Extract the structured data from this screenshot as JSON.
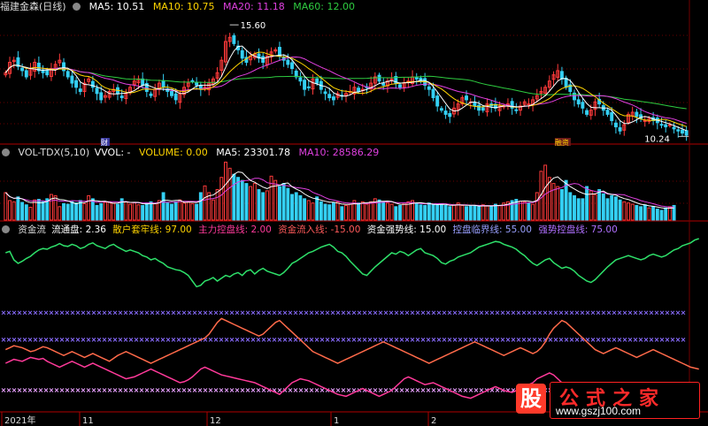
{
  "main_header": {
    "title": "福建金森(日线)",
    "ma5": "MA5: 10.51",
    "ma10": "MA10: 10.75",
    "ma20": "MA20: 11.18",
    "ma60": "MA60: 12.00"
  },
  "vol_header": {
    "title": "VOL-TDX(5,10)",
    "vvol": "VVOL: -",
    "volume": "VOLUME: 0.00",
    "ma5": "MA5: 23301.78",
    "ma10": "MA10: 28586.29"
  },
  "fund_header": {
    "title": "资金流",
    "float_cap": "流通盘: 2.36",
    "retail": "散户套牢线: 97.00",
    "main_control": "主力控盘线: 2.00",
    "inflow": "资金流入线: -15.00",
    "strong": "资金强势线: 15.00",
    "critical": "控盘临界线: 55.00",
    "strong_control": "强势控盘线: 75.00"
  },
  "annotations": {
    "high": "15.60",
    "low": "10.24",
    "tag1": "财",
    "tag2": "融资"
  },
  "x_axis": [
    "2021年",
    "11",
    "12",
    "1",
    "2"
  ],
  "watermark": {
    "stock": "股",
    "brand": "公式之家",
    "url": "www.gszj100.com"
  },
  "colors": {
    "up": "#ff3a3a",
    "down": "#34d0f4",
    "ma5": "#ffffff",
    "ma10": "#ffd400",
    "ma20": "#e040e0",
    "ma60": "#2ecc40",
    "fund": "#2ee06a",
    "pink": "#ff3a9a",
    "orange": "#ff6a4a",
    "xline": "#8a6cff"
  },
  "chart_data": [
    {
      "type": "candlestick",
      "title": "福建金森(日线)",
      "series": [
        {
          "name": "MA5",
          "value": 10.51
        },
        {
          "name": "MA10",
          "value": 10.75
        },
        {
          "name": "MA20",
          "value": 11.18
        },
        {
          "name": "MA60",
          "value": 12.0
        }
      ],
      "annotations": [
        {
          "label": "15.60",
          "kind": "high"
        },
        {
          "label": "10.24",
          "kind": "low"
        }
      ],
      "ylim": [
        10.0,
        16.2
      ],
      "close": [
        13.3,
        13.8,
        13.9,
        13.6,
        13.4,
        13.1,
        13.5,
        13.8,
        13.4,
        13.3,
        13.2,
        13.5,
        13.7,
        13.9,
        13.4,
        13.1,
        12.8,
        12.6,
        12.4,
        12.8,
        13.0,
        12.6,
        12.3,
        12.0,
        12.2,
        12.4,
        12.5,
        12.3,
        12.1,
        12.3,
        12.6,
        12.9,
        13.0,
        12.7,
        12.4,
        12.2,
        12.5,
        12.8,
        12.6,
        12.4,
        12.2,
        12.0,
        12.3,
        12.6,
        12.8,
        12.9,
        12.7,
        12.5,
        12.6,
        12.8,
        13.0,
        13.3,
        13.9,
        14.8,
        15.0,
        14.7,
        14.4,
        14.0,
        13.8,
        14.1,
        14.2,
        14.0,
        13.8,
        14.1,
        14.3,
        14.4,
        14.1,
        13.9,
        13.7,
        13.5,
        13.1,
        12.9,
        12.5,
        12.6,
        13.0,
        12.8,
        12.5,
        12.3,
        12.1,
        12.0,
        12.3,
        12.2,
        12.3,
        12.4,
        12.6,
        12.4,
        12.5,
        12.6,
        12.8,
        13.1,
        12.9,
        12.7,
        12.9,
        13.0,
        12.8,
        12.6,
        12.8,
        12.9,
        13.1,
        13.0,
        12.9,
        12.7,
        12.5,
        12.1,
        11.7,
        11.5,
        11.3,
        11.2,
        11.6,
        11.8,
        12.1,
        12.0,
        11.9,
        11.7,
        11.5,
        11.5,
        11.8,
        11.7,
        11.6,
        11.7,
        11.7,
        11.8,
        11.6,
        11.5,
        11.7,
        11.9,
        11.8,
        12.0,
        12.2,
        12.4,
        12.6,
        12.9,
        13.2,
        13.4,
        13.0,
        12.6,
        12.4,
        12.0,
        11.8,
        11.6,
        11.3,
        11.5,
        11.9,
        11.8,
        11.5,
        11.3,
        11.0,
        10.7,
        10.5,
        10.8,
        11.3,
        11.4,
        11.2,
        11.1,
        11.0,
        11.1,
        11.0,
        10.9,
        10.8,
        10.7,
        10.8,
        10.6,
        10.5,
        10.4,
        10.3
      ]
    },
    {
      "type": "bar",
      "title": "VOL-TDX(5,10)",
      "series": [
        {
          "name": "VOLUME",
          "value": 0.0
        },
        {
          "name": "MA5",
          "value": 23301.78
        },
        {
          "name": "MA10",
          "value": 28586.29
        }
      ],
      "ylim": [
        0,
        100000
      ],
      "values": [
        45000,
        32000,
        30000,
        38000,
        29000,
        25000,
        21000,
        33000,
        34000,
        30000,
        35000,
        42000,
        40000,
        22000,
        27000,
        26000,
        30000,
        28000,
        32000,
        27000,
        40000,
        35000,
        24000,
        27000,
        29000,
        30000,
        28000,
        26000,
        35000,
        30000,
        26000,
        29000,
        25000,
        24000,
        28000,
        30000,
        27000,
        32000,
        45000,
        28000,
        26000,
        30000,
        33000,
        28000,
        30000,
        27000,
        26000,
        45000,
        56000,
        45000,
        33000,
        50000,
        70000,
        95000,
        85000,
        75000,
        70000,
        65000,
        60000,
        55000,
        60000,
        50000,
        45000,
        48000,
        72000,
        65000,
        55000,
        60000,
        52000,
        42000,
        45000,
        40000,
        35000,
        32000,
        28000,
        38000,
        30000,
        26000,
        25000,
        28000,
        30000,
        22000,
        24000,
        26000,
        32000,
        28000,
        30000,
        26000,
        30000,
        35000,
        33000,
        30000,
        28000,
        26000,
        22000,
        24000,
        28000,
        30000,
        32000,
        27000,
        25000,
        24000,
        28000,
        26000,
        24000,
        26000,
        24000,
        22000,
        25000,
        28000,
        24000,
        22000,
        23000,
        24000,
        22000,
        25000,
        23000,
        22000,
        26000,
        24000,
        28000,
        30000,
        32000,
        34000,
        31000,
        30000,
        28000,
        26000,
        45000,
        80000,
        90000,
        70000,
        60000,
        55000,
        50000,
        65000,
        45000,
        40000,
        35000,
        35000,
        55000,
        48000,
        42000,
        50000,
        43000,
        35000,
        40000,
        38000,
        33000,
        30000,
        28000,
        26000,
        24000,
        22000,
        25000,
        20000,
        22000,
        18000,
        16000,
        20000,
        22000,
        24000
      ]
    },
    {
      "type": "line",
      "title": "资金流",
      "series": [
        {
          "name": "流通盘",
          "value": 2.36
        }
      ],
      "reference_lines": [
        {
          "name": "散户套牢线",
          "value": 97
        },
        {
          "name": "主力控盘线",
          "value": 2
        },
        {
          "name": "资金流入线",
          "value": -15
        },
        {
          "name": "资金强势线",
          "value": 15
        },
        {
          "name": "控盘临界线",
          "value": 55
        },
        {
          "name": "强势控盘线",
          "value": 75
        }
      ],
      "green": [
        70,
        72,
        60,
        55,
        58,
        62,
        65,
        70,
        74,
        76,
        75,
        78,
        80,
        83,
        80,
        79,
        82,
        80,
        76,
        78,
        82,
        84,
        80,
        78,
        76,
        80,
        82,
        78,
        75,
        72,
        74,
        72,
        70,
        66,
        64,
        60,
        62,
        58,
        55,
        50,
        48,
        46,
        45,
        42,
        38,
        30,
        22,
        24,
        30,
        32,
        35,
        30,
        34,
        38,
        36,
        40,
        42,
        38,
        44,
        46,
        40,
        45,
        48,
        44,
        42,
        40,
        38,
        42,
        48,
        55,
        58,
        62,
        66,
        70,
        72,
        75,
        78,
        80,
        82,
        78,
        72,
        70,
        65,
        58,
        52,
        46,
        40,
        38,
        44,
        50,
        55,
        60,
        65,
        70,
        68,
        72,
        70,
        66,
        70,
        74,
        76,
        70,
        68,
        66,
        62,
        56,
        54,
        58,
        60,
        64,
        66,
        68,
        70,
        74,
        78,
        80,
        82,
        84,
        86,
        85,
        82,
        80,
        78,
        75,
        70,
        66,
        60,
        55,
        52,
        56,
        60,
        62,
        56,
        52,
        48,
        50,
        48,
        44,
        38,
        34,
        30,
        28,
        32,
        38,
        44,
        50,
        55,
        60,
        62,
        64,
        66,
        64,
        62,
        60,
        62,
        66,
        68,
        66,
        64,
        66,
        70,
        74,
        76,
        80,
        82,
        84,
        88,
        90
      ],
      "pink": [
        50,
        52,
        54,
        53,
        52,
        54,
        56,
        55,
        54,
        55,
        52,
        50,
        48,
        46,
        48,
        50,
        52,
        50,
        48,
        46,
        48,
        50,
        48,
        46,
        44,
        42,
        40,
        38,
        36,
        34,
        35,
        36,
        38,
        40,
        42,
        44,
        42,
        40,
        38,
        36,
        34,
        32,
        30,
        31,
        33,
        36,
        40,
        44,
        46,
        44,
        42,
        40,
        38,
        37,
        36,
        35,
        34,
        33,
        32,
        31,
        30,
        28,
        26,
        24,
        22,
        20,
        18,
        22,
        26,
        30,
        32,
        34,
        33,
        32,
        30,
        28,
        26,
        24,
        22,
        20,
        18,
        17,
        16,
        18,
        20,
        22,
        24,
        22,
        20,
        18,
        16,
        18,
        20,
        22,
        26,
        30,
        34,
        36,
        34,
        32,
        30,
        28,
        29,
        30,
        28,
        26,
        24,
        22,
        20,
        18,
        16,
        15,
        14,
        16,
        18,
        20,
        22,
        24,
        26,
        24,
        22,
        21,
        20,
        22,
        24,
        26,
        28,
        30,
        34,
        36,
        38,
        40,
        38,
        34,
        30,
        26,
        24,
        22,
        20,
        18,
        17,
        16,
        15,
        16,
        18,
        20,
        22,
        24,
        26,
        28,
        26,
        24,
        22,
        20,
        18,
        20,
        22,
        24,
        26,
        24,
        22,
        20,
        18,
        17,
        16,
        15,
        14
      ],
      "orange": [
        64,
        66,
        68,
        67,
        66,
        64,
        62,
        63,
        65,
        67,
        66,
        64,
        62,
        60,
        58,
        60,
        62,
        60,
        58,
        56,
        58,
        60,
        58,
        56,
        54,
        52,
        55,
        58,
        60,
        62,
        60,
        58,
        56,
        54,
        52,
        50,
        52,
        54,
        56,
        58,
        60,
        62,
        64,
        66,
        68,
        70,
        72,
        74,
        76,
        80,
        86,
        92,
        96,
        94,
        92,
        90,
        88,
        86,
        84,
        82,
        80,
        78,
        80,
        84,
        88,
        92,
        94,
        90,
        86,
        82,
        78,
        74,
        70,
        66,
        62,
        60,
        58,
        56,
        54,
        52,
        50,
        52,
        54,
        56,
        58,
        60,
        62,
        64,
        66,
        68,
        70,
        72,
        70,
        68,
        66,
        64,
        62,
        60,
        58,
        56,
        54,
        52,
        50,
        52,
        54,
        56,
        58,
        60,
        62,
        64,
        66,
        68,
        70,
        72,
        70,
        68,
        66,
        64,
        62,
        60,
        58,
        60,
        62,
        64,
        66,
        64,
        62,
        60,
        62,
        66,
        72,
        80,
        86,
        90,
        94,
        92,
        88,
        84,
        80,
        76,
        72,
        68,
        64,
        62,
        60,
        62,
        64,
        66,
        64,
        62,
        60,
        58,
        56,
        58,
        60,
        62,
        64,
        62,
        60,
        58,
        56,
        54,
        52,
        50,
        48,
        46,
        45,
        44
      ]
    }
  ]
}
